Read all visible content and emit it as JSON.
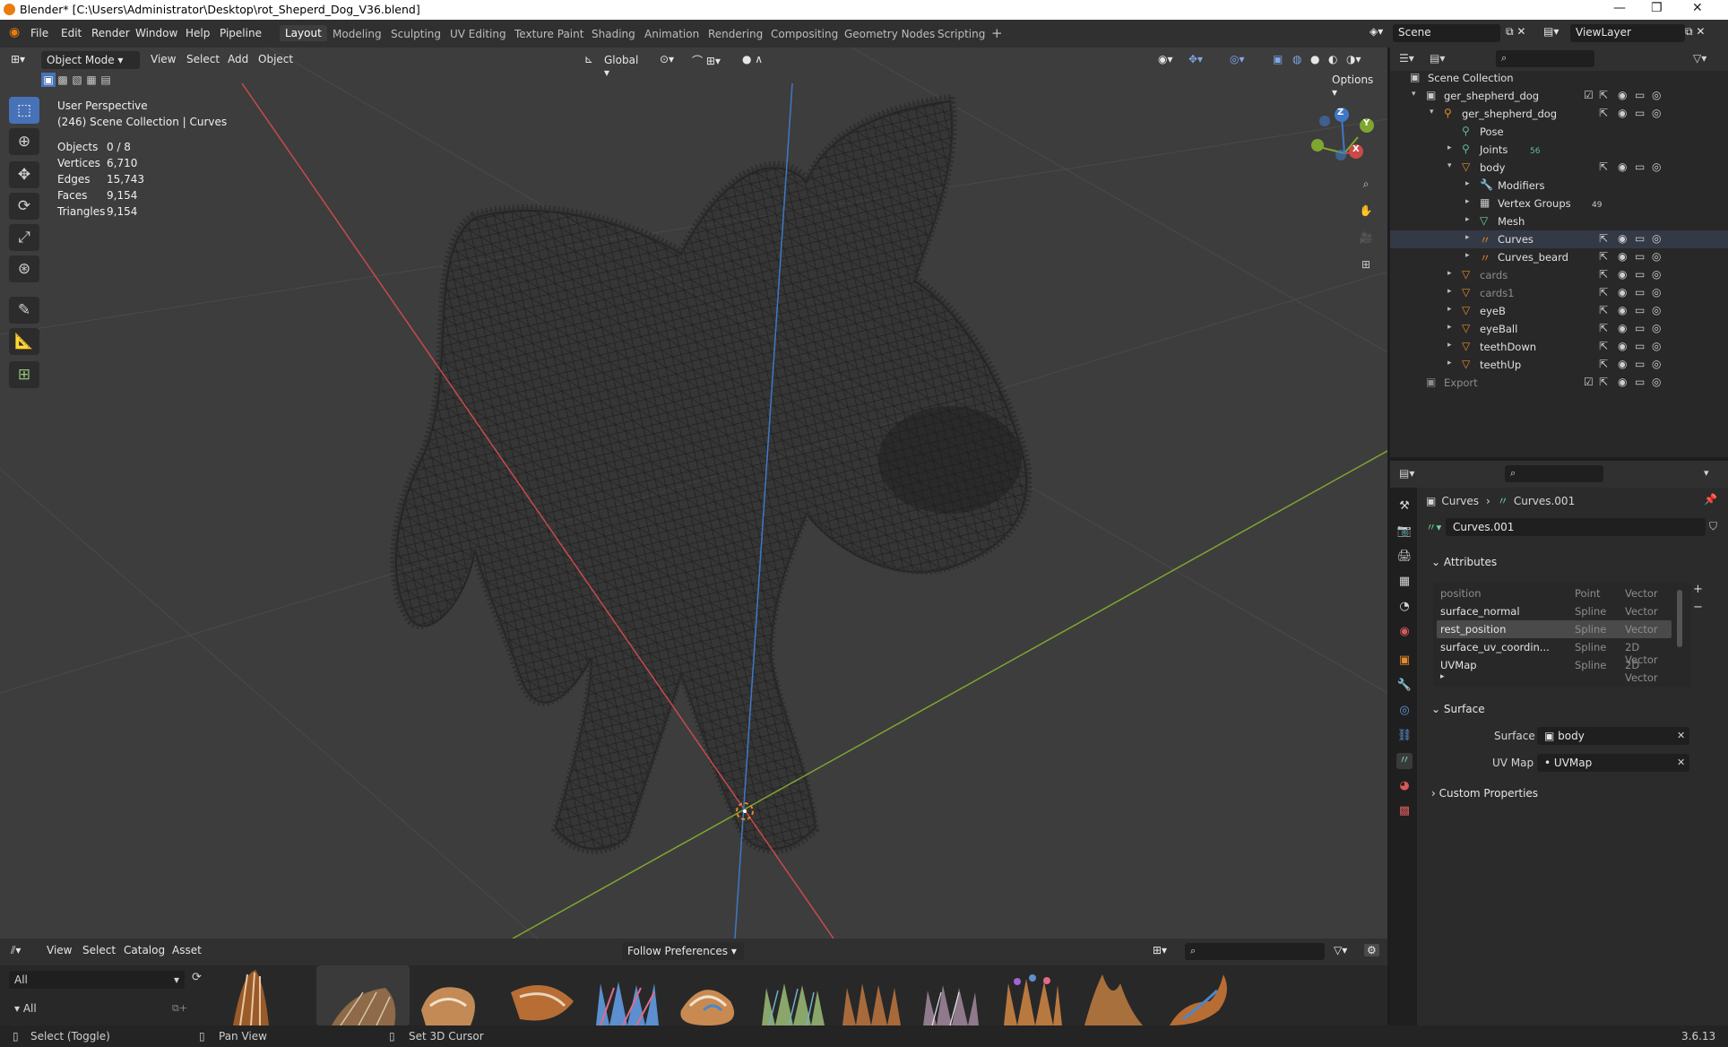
{
  "titlebar": {
    "title": "Blender* [C:\\Users\\Administrator\\Desktop\\rot_Sheperd_Dog_V36.blend]",
    "minimize": "—",
    "maximize": "❐",
    "close": "✕"
  },
  "menu": {
    "items": [
      "File",
      "Edit",
      "Render",
      "Window",
      "Help",
      "Pipeline"
    ]
  },
  "workspaces": {
    "tabs": [
      "Layout",
      "Modeling",
      "Sculpting",
      "UV Editing",
      "Texture Paint",
      "Shading",
      "Animation",
      "Rendering",
      "Compositing",
      "Geometry Nodes",
      "Scripting"
    ],
    "active": "Layout",
    "add": "+"
  },
  "scene": {
    "name": "Scene",
    "view_layer": "ViewLayer"
  },
  "viewport": {
    "mode": "Object Mode",
    "menus": [
      "View",
      "Select",
      "Add",
      "Object"
    ],
    "orientation": "Global",
    "options": "Options",
    "overlay_title": "User Perspective",
    "overlay_sub": "(246) Scene Collection | Curves",
    "stats": [
      {
        "label": "Objects",
        "value": "0 / 8"
      },
      {
        "label": "Vertices",
        "value": "6,710"
      },
      {
        "label": "Edges",
        "value": "15,743"
      },
      {
        "label": "Faces",
        "value": "9,154"
      },
      {
        "label": "Triangles",
        "value": "9,154"
      }
    ],
    "gizmo": {
      "x": "X",
      "y": "Y",
      "z": "Z"
    }
  },
  "outliner": {
    "root": "Scene Collection",
    "rows": [
      {
        "name": "ger_shepherd_dog",
        "extra": ""
      },
      {
        "name": "ger_shepherd_dog",
        "extra": ""
      },
      {
        "name": "Pose",
        "extra": ""
      },
      {
        "name": "Joints",
        "extra": "56"
      },
      {
        "name": "body",
        "extra": ""
      },
      {
        "name": "Modifiers",
        "extra": ""
      },
      {
        "name": "Vertex Groups",
        "extra": "49"
      },
      {
        "name": "Mesh",
        "extra": ""
      },
      {
        "name": "Curves",
        "extra": ""
      },
      {
        "name": "Curves_beard",
        "extra": ""
      },
      {
        "name": "cards",
        "extra": ""
      },
      {
        "name": "cards1",
        "extra": ""
      },
      {
        "name": "eyeB",
        "extra": ""
      },
      {
        "name": "eyeBall",
        "extra": ""
      },
      {
        "name": "teethDown",
        "extra": ""
      },
      {
        "name": "teethUp",
        "extra": ""
      },
      {
        "name": "Export",
        "extra": ""
      }
    ]
  },
  "properties": {
    "breadcrumb": [
      "Curves",
      "Curves.001"
    ],
    "data_name": "Curves.001",
    "attributes_title": "Attributes",
    "attributes": [
      {
        "name": "position",
        "domain": "Point",
        "type": "Vector"
      },
      {
        "name": "surface_normal",
        "domain": "Spline",
        "type": "Vector"
      },
      {
        "name": "rest_position",
        "domain": "Spline",
        "type": "Vector"
      },
      {
        "name": "surface_uv_coordin...",
        "domain": "Spline",
        "type": "2D Vector"
      },
      {
        "name": "UVMap",
        "domain": "Spline",
        "type": "2D Vector"
      }
    ],
    "surface_title": "Surface",
    "surface_label": "Surface",
    "surface_value": "body",
    "uvmap_label": "UV Map",
    "uvmap_value": "UVMap",
    "custom_title": "Custom Properties"
  },
  "assets": {
    "menus": [
      "View",
      "Select",
      "Catalog",
      "Asset"
    ],
    "library": "Follow Preferences",
    "filter": "All",
    "catalog": "All"
  },
  "status": {
    "select": "Select (Toggle)",
    "pan": "Pan View",
    "cursor": "Set 3D Cursor",
    "version": "3.6.13"
  },
  "colors": {
    "accent": "#4872b8",
    "x_axis": "#c94a4a",
    "y_axis": "#7fa630",
    "z_axis": "#3f78c7",
    "orange": "#e6892a"
  }
}
